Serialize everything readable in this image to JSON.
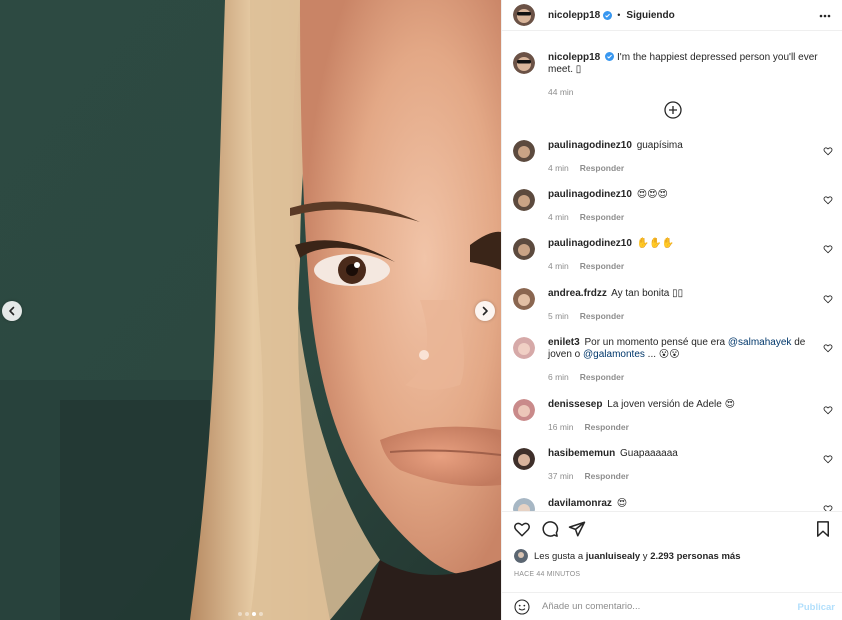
{
  "post": {
    "author": "nicolepp18",
    "follow_status": "Siguiendo",
    "separator": "•",
    "images_count": 4,
    "active_image": 3
  },
  "caption": {
    "user": "nicolepp18",
    "text": "I'm the happiest depressed person you'll ever meet. ▯",
    "time": "44 min"
  },
  "comments": [
    {
      "user": "paulinagodinez10",
      "text": "guapísima",
      "time": "4 min",
      "reply": "Responder"
    },
    {
      "user": "paulinagodinez10",
      "text": "😍😍😍",
      "time": "4 min",
      "reply": "Responder"
    },
    {
      "user": "paulinagodinez10",
      "text": "✋✋✋",
      "time": "4 min",
      "reply": "Responder"
    },
    {
      "user": "andrea.frdzz",
      "text": "Ay tan bonita ▯▯",
      "time": "5 min",
      "reply": "Responder"
    },
    {
      "user": "enilet3",
      "text_pre": "Por un momento pensé que era ",
      "mention1": "@salmahayek",
      "text_mid": " de joven o ",
      "mention2": "@galamontes",
      "text_post": " ... 😮😮",
      "time": "6 min",
      "reply": "Responder"
    },
    {
      "user": "denissesep",
      "text": "La joven versión de Adele 😍",
      "time": "16 min",
      "reply": "Responder"
    },
    {
      "user": "hasibememun",
      "text": "Guapaaaaaa",
      "time": "37 min",
      "reply": "Responder"
    },
    {
      "user": "davilamonraz",
      "text": "😍",
      "time": "",
      "reply": ""
    }
  ],
  "likes": {
    "prefix": "Les gusta a",
    "user": "juanluisealy",
    "connector": "y",
    "count": "2.293 personas más"
  },
  "timestamp": "HACE 44 MINUTOS",
  "composer": {
    "placeholder": "Añade un comentario...",
    "post_label": "Publicar"
  },
  "icons": {
    "verified": "verified-badge-icon",
    "more": "more-options-icon",
    "load_more": "plus-circle-icon",
    "like": "heart-icon",
    "comment": "comment-bubble-icon",
    "share": "paper-plane-icon",
    "save": "bookmark-icon",
    "emoji": "emoji-smile-icon",
    "prev": "chevron-left-icon",
    "next": "chevron-right-icon"
  },
  "colors": {
    "verified": "#3897f0",
    "link": "#00376b",
    "muted": "#8e8e8e",
    "publish_disabled": "#b2dffc"
  }
}
